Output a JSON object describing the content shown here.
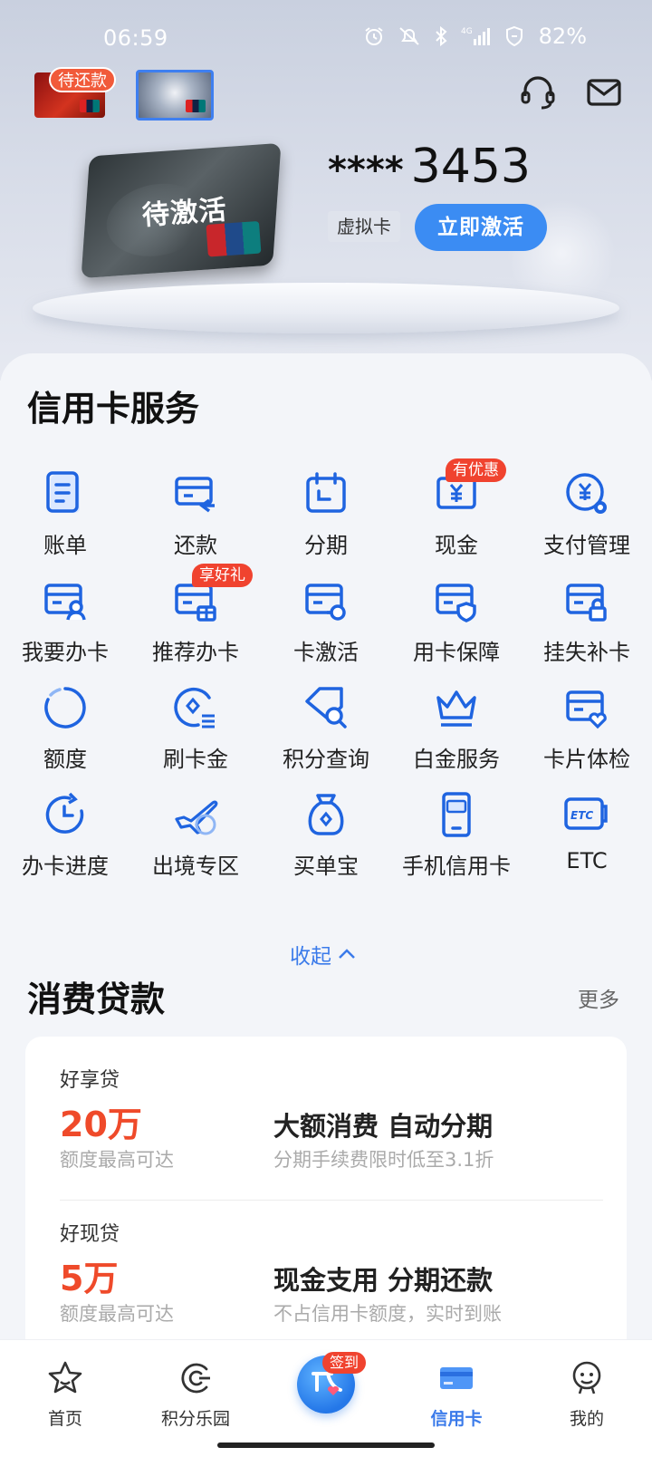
{
  "status_bar": {
    "time": "06:59",
    "network": "4G",
    "battery": "82%"
  },
  "header": {
    "pending_badge": "待还款"
  },
  "hero_card": {
    "status_label": "待激活",
    "mask": "****",
    "last_digits": "3453",
    "type_label": "虚拟卡",
    "activate_label": "立即激活"
  },
  "services": {
    "title": "信用卡服务",
    "items": [
      {
        "label": "账单",
        "icon": "bill-icon"
      },
      {
        "label": "还款",
        "icon": "repay-icon"
      },
      {
        "label": "分期",
        "icon": "calendar-icon"
      },
      {
        "label": "现金",
        "icon": "cash-icon",
        "badge": "有优惠"
      },
      {
        "label": "支付管理",
        "icon": "pay-settings-icon"
      },
      {
        "label": "我要办卡",
        "icon": "apply-card-icon"
      },
      {
        "label": "推荐办卡",
        "icon": "recommend-card-icon",
        "badge": "享好礼"
      },
      {
        "label": "卡激活",
        "icon": "card-activate-icon"
      },
      {
        "label": "用卡保障",
        "icon": "card-protect-icon"
      },
      {
        "label": "挂失补卡",
        "icon": "card-lock-icon"
      },
      {
        "label": "额度",
        "icon": "limit-icon"
      },
      {
        "label": "刷卡金",
        "icon": "swipe-reward-icon"
      },
      {
        "label": "积分查询",
        "icon": "points-search-icon"
      },
      {
        "label": "白金服务",
        "icon": "crown-icon"
      },
      {
        "label": "卡片体检",
        "icon": "card-health-icon"
      },
      {
        "label": "办卡进度",
        "icon": "progress-icon"
      },
      {
        "label": "出境专区",
        "icon": "plane-icon"
      },
      {
        "label": "买单宝",
        "icon": "money-bag-icon"
      },
      {
        "label": "手机信用卡",
        "icon": "phone-card-icon"
      },
      {
        "label": "ETC",
        "icon": "etc-icon"
      }
    ],
    "collapse_label": "收起"
  },
  "loans": {
    "title": "消费贷款",
    "more_label": "更多",
    "items": [
      {
        "name": "好享贷",
        "amount": "20万",
        "amount_sub": "额度最高可达",
        "headline": "大额消费 自动分期",
        "desc": "分期手续费限时低至3.1折"
      },
      {
        "name": "好现贷",
        "amount": "5万",
        "amount_sub": "额度最高可达",
        "headline": "现金支用 分期还款",
        "desc": "不占信用卡额度，实时到账"
      }
    ]
  },
  "tabbar": {
    "items": [
      {
        "label": "首页",
        "icon": "home-star-icon"
      },
      {
        "label": "积分乐园",
        "icon": "points-park-icon"
      },
      {
        "label": "信用卡",
        "icon": "credit-card-icon",
        "active": true
      },
      {
        "label": "我的",
        "icon": "profile-icon"
      }
    ],
    "center_badge": "签到"
  },
  "colors": {
    "accent": "#3b7bea",
    "badge_red": "#f0432f",
    "amount_red": "#ef4a2a",
    "button_blue": "#3b8cf3"
  }
}
